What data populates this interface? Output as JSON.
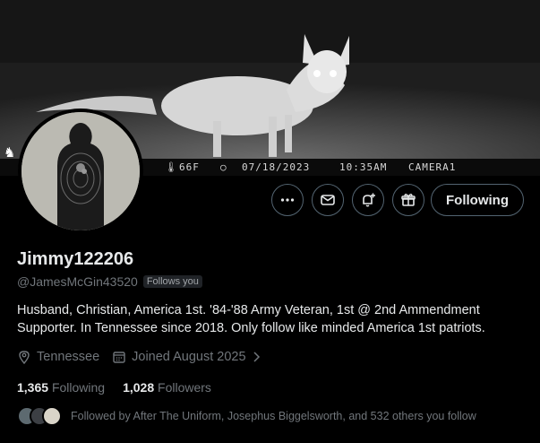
{
  "banner": {
    "temperature": "66F",
    "date": "07/18/2023",
    "time": "10:35AM",
    "camera": "CAMERA1"
  },
  "actions": {
    "more_icon": "more-icon",
    "message_icon": "mail-icon",
    "notify_icon": "bell-plus-icon",
    "gift_icon": "gift-icon",
    "follow_label": "Following"
  },
  "profile": {
    "name": "Jimmy122206",
    "handle": "@JamesMcGin43520",
    "follows_you": "Follows you",
    "bio_line1": "Husband, Christian, America 1st. '84-'88 Army Veteran, 1st @ 2nd Ammendment",
    "bio_line2": "Supporter. In Tennessee since 2018. Only follow like minded America 1st patriots.",
    "location": "Tennessee",
    "joined": "Joined August 2025"
  },
  "stats": {
    "following_count": "1,365",
    "following_label": "Following",
    "followers_count": "1,028",
    "followers_label": "Followers"
  },
  "followed_by": "Followed by After The Uniform, Josephus Biggelsworth, and 532 others you follow",
  "colors": {
    "background": "#000000",
    "text": "#e7e9ea",
    "muted": "#71767b",
    "border": "#536471"
  }
}
